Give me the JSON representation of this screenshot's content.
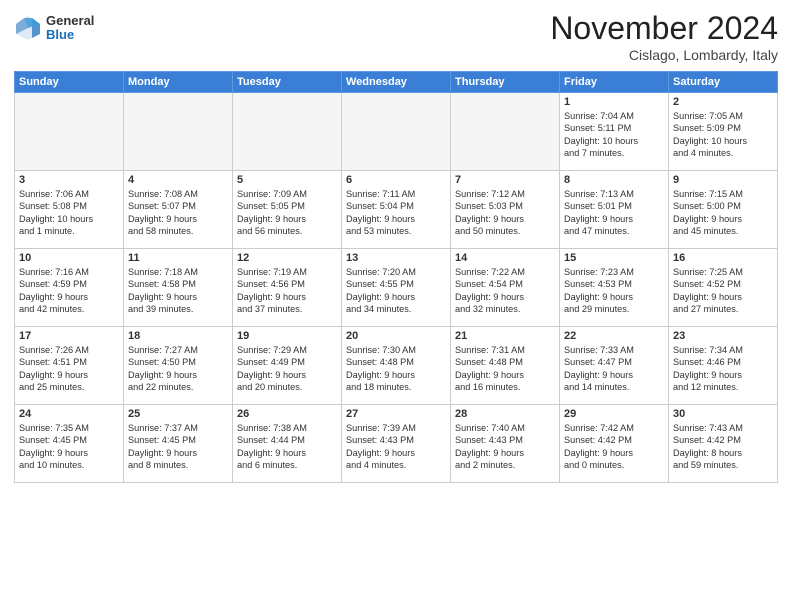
{
  "header": {
    "logo_general": "General",
    "logo_blue": "Blue",
    "month_title": "November 2024",
    "location": "Cislago, Lombardy, Italy"
  },
  "weekdays": [
    "Sunday",
    "Monday",
    "Tuesday",
    "Wednesday",
    "Thursday",
    "Friday",
    "Saturday"
  ],
  "weeks": [
    [
      {
        "day": "",
        "info": "",
        "empty": true
      },
      {
        "day": "",
        "info": "",
        "empty": true
      },
      {
        "day": "",
        "info": "",
        "empty": true
      },
      {
        "day": "",
        "info": "",
        "empty": true
      },
      {
        "day": "",
        "info": "",
        "empty": true
      },
      {
        "day": "1",
        "info": "Sunrise: 7:04 AM\nSunset: 5:11 PM\nDaylight: 10 hours\nand 7 minutes.",
        "empty": false
      },
      {
        "day": "2",
        "info": "Sunrise: 7:05 AM\nSunset: 5:09 PM\nDaylight: 10 hours\nand 4 minutes.",
        "empty": false
      }
    ],
    [
      {
        "day": "3",
        "info": "Sunrise: 7:06 AM\nSunset: 5:08 PM\nDaylight: 10 hours\nand 1 minute.",
        "empty": false
      },
      {
        "day": "4",
        "info": "Sunrise: 7:08 AM\nSunset: 5:07 PM\nDaylight: 9 hours\nand 58 minutes.",
        "empty": false
      },
      {
        "day": "5",
        "info": "Sunrise: 7:09 AM\nSunset: 5:05 PM\nDaylight: 9 hours\nand 56 minutes.",
        "empty": false
      },
      {
        "day": "6",
        "info": "Sunrise: 7:11 AM\nSunset: 5:04 PM\nDaylight: 9 hours\nand 53 minutes.",
        "empty": false
      },
      {
        "day": "7",
        "info": "Sunrise: 7:12 AM\nSunset: 5:03 PM\nDaylight: 9 hours\nand 50 minutes.",
        "empty": false
      },
      {
        "day": "8",
        "info": "Sunrise: 7:13 AM\nSunset: 5:01 PM\nDaylight: 9 hours\nand 47 minutes.",
        "empty": false
      },
      {
        "day": "9",
        "info": "Sunrise: 7:15 AM\nSunset: 5:00 PM\nDaylight: 9 hours\nand 45 minutes.",
        "empty": false
      }
    ],
    [
      {
        "day": "10",
        "info": "Sunrise: 7:16 AM\nSunset: 4:59 PM\nDaylight: 9 hours\nand 42 minutes.",
        "empty": false
      },
      {
        "day": "11",
        "info": "Sunrise: 7:18 AM\nSunset: 4:58 PM\nDaylight: 9 hours\nand 39 minutes.",
        "empty": false
      },
      {
        "day": "12",
        "info": "Sunrise: 7:19 AM\nSunset: 4:56 PM\nDaylight: 9 hours\nand 37 minutes.",
        "empty": false
      },
      {
        "day": "13",
        "info": "Sunrise: 7:20 AM\nSunset: 4:55 PM\nDaylight: 9 hours\nand 34 minutes.",
        "empty": false
      },
      {
        "day": "14",
        "info": "Sunrise: 7:22 AM\nSunset: 4:54 PM\nDaylight: 9 hours\nand 32 minutes.",
        "empty": false
      },
      {
        "day": "15",
        "info": "Sunrise: 7:23 AM\nSunset: 4:53 PM\nDaylight: 9 hours\nand 29 minutes.",
        "empty": false
      },
      {
        "day": "16",
        "info": "Sunrise: 7:25 AM\nSunset: 4:52 PM\nDaylight: 9 hours\nand 27 minutes.",
        "empty": false
      }
    ],
    [
      {
        "day": "17",
        "info": "Sunrise: 7:26 AM\nSunset: 4:51 PM\nDaylight: 9 hours\nand 25 minutes.",
        "empty": false
      },
      {
        "day": "18",
        "info": "Sunrise: 7:27 AM\nSunset: 4:50 PM\nDaylight: 9 hours\nand 22 minutes.",
        "empty": false
      },
      {
        "day": "19",
        "info": "Sunrise: 7:29 AM\nSunset: 4:49 PM\nDaylight: 9 hours\nand 20 minutes.",
        "empty": false
      },
      {
        "day": "20",
        "info": "Sunrise: 7:30 AM\nSunset: 4:48 PM\nDaylight: 9 hours\nand 18 minutes.",
        "empty": false
      },
      {
        "day": "21",
        "info": "Sunrise: 7:31 AM\nSunset: 4:48 PM\nDaylight: 9 hours\nand 16 minutes.",
        "empty": false
      },
      {
        "day": "22",
        "info": "Sunrise: 7:33 AM\nSunset: 4:47 PM\nDaylight: 9 hours\nand 14 minutes.",
        "empty": false
      },
      {
        "day": "23",
        "info": "Sunrise: 7:34 AM\nSunset: 4:46 PM\nDaylight: 9 hours\nand 12 minutes.",
        "empty": false
      }
    ],
    [
      {
        "day": "24",
        "info": "Sunrise: 7:35 AM\nSunset: 4:45 PM\nDaylight: 9 hours\nand 10 minutes.",
        "empty": false
      },
      {
        "day": "25",
        "info": "Sunrise: 7:37 AM\nSunset: 4:45 PM\nDaylight: 9 hours\nand 8 minutes.",
        "empty": false
      },
      {
        "day": "26",
        "info": "Sunrise: 7:38 AM\nSunset: 4:44 PM\nDaylight: 9 hours\nand 6 minutes.",
        "empty": false
      },
      {
        "day": "27",
        "info": "Sunrise: 7:39 AM\nSunset: 4:43 PM\nDaylight: 9 hours\nand 4 minutes.",
        "empty": false
      },
      {
        "day": "28",
        "info": "Sunrise: 7:40 AM\nSunset: 4:43 PM\nDaylight: 9 hours\nand 2 minutes.",
        "empty": false
      },
      {
        "day": "29",
        "info": "Sunrise: 7:42 AM\nSunset: 4:42 PM\nDaylight: 9 hours\nand 0 minutes.",
        "empty": false
      },
      {
        "day": "30",
        "info": "Sunrise: 7:43 AM\nSunset: 4:42 PM\nDaylight: 8 hours\nand 59 minutes.",
        "empty": false
      }
    ]
  ]
}
